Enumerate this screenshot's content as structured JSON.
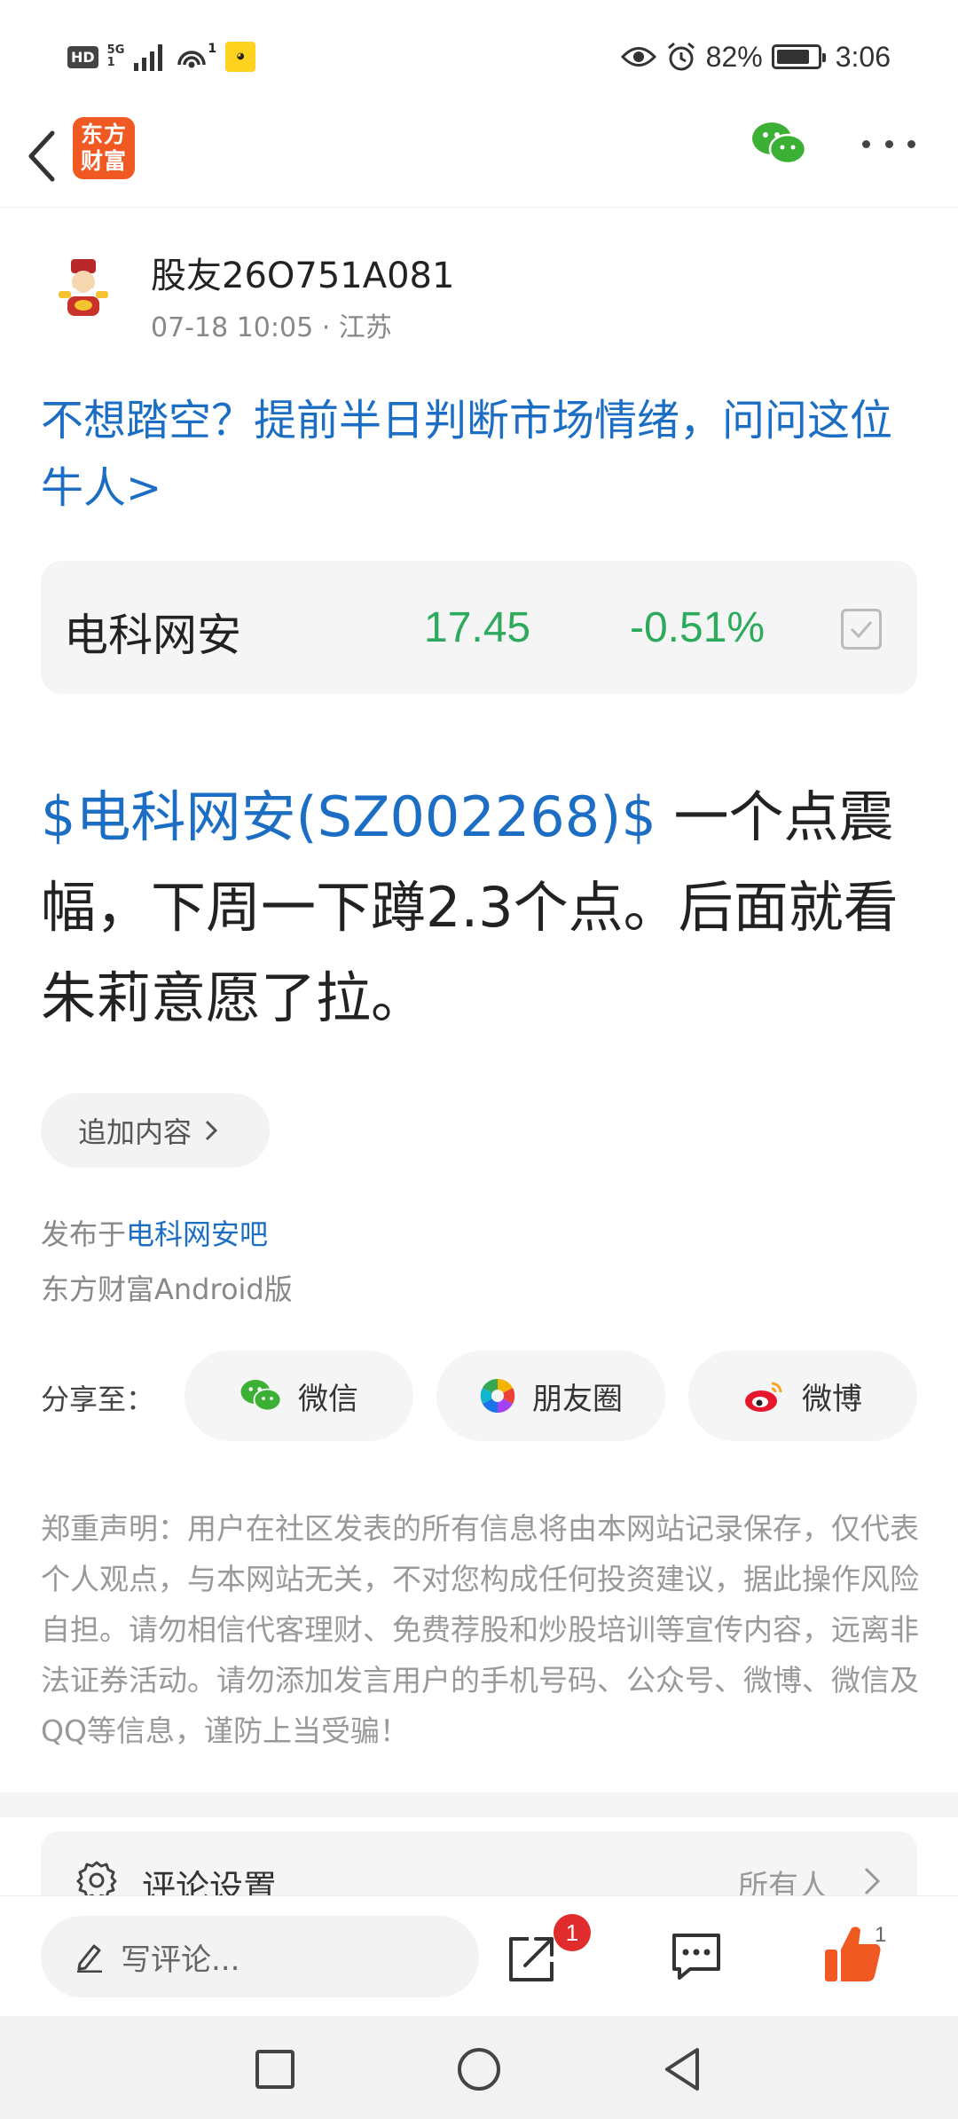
{
  "status_bar": {
    "hd": "HD",
    "signal_top": "5G",
    "signal_bottom": "1",
    "hotspot_count": "1",
    "battery_percent": "82%",
    "battery_level": 0.82,
    "time": "3:06"
  },
  "header": {
    "logo_line1": "东方",
    "logo_line2": "财富",
    "logo_color": "#f05a22"
  },
  "author": {
    "name": "股友26O751A081",
    "meta": "07-18 10:05 · 江苏"
  },
  "promo": {
    "text": "不想踏空？提前半日判断市场情绪，问问这位牛人>"
  },
  "stock_card": {
    "name": "电科网安",
    "price": "17.45",
    "change": "-0.51%",
    "color": "#2eaa5c"
  },
  "post": {
    "stock_link": "$电科网安(SZ002268)$",
    "text": " 一个点震幅，下周一下蹲2.3个点。后面就看朱莉意愿了拉。"
  },
  "append": {
    "label": "追加内容"
  },
  "published": {
    "prefix": "发布于",
    "bar": "电科网安吧",
    "client": "东方财富Android版"
  },
  "share": {
    "label": "分享至：",
    "wechat": "微信",
    "moments": "朋友圈",
    "weibo": "微博"
  },
  "disclaimer": "郑重声明：用户在社区发表的所有信息将由本网站记录保存，仅代表个人观点，与本网站无关，不对您构成任何投资建议，据此操作风险自担。请勿相信代客理财、免费荐股和炒股培训等宣传内容，远离非法证券活动。请勿添加发言用户的手机号码、公众号、微博、微信及QQ等信息，谨防上当受骗！",
  "comment_settings": {
    "label": "评论设置",
    "value": "所有人"
  },
  "action_bar": {
    "write_placeholder": "写评论...",
    "share_badge": "1",
    "like_count": "1"
  },
  "colors": {
    "link": "#1c6ec5",
    "accent": "#f05a22",
    "stock_down": "#2eaa5c",
    "badge": "#e02c2c"
  }
}
